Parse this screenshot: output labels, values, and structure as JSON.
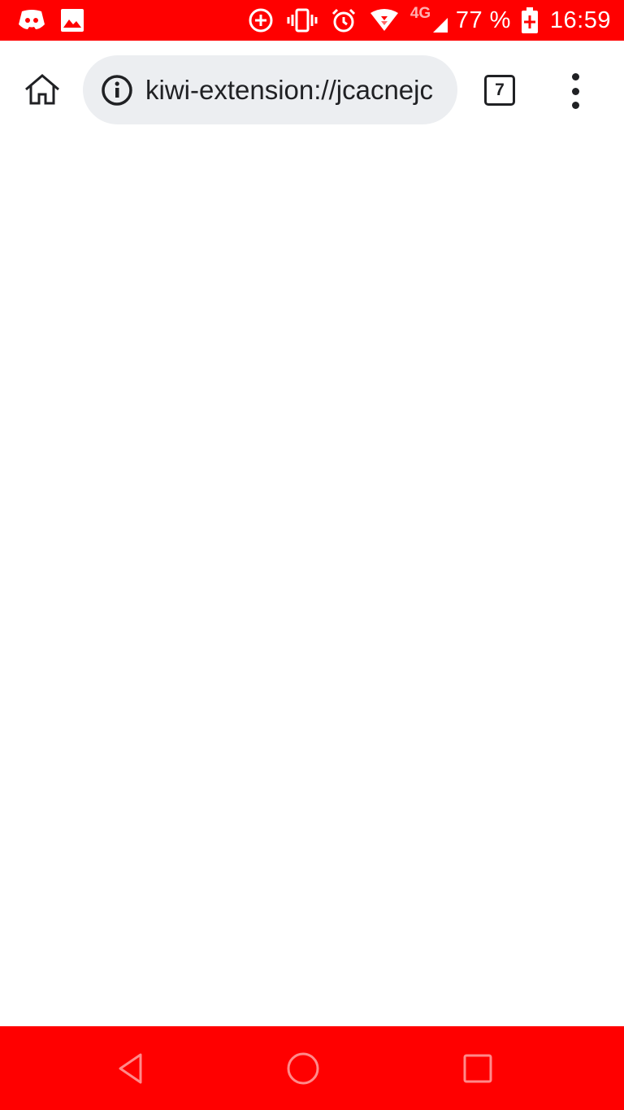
{
  "status_bar": {
    "background": "#ff0000",
    "left_icons": [
      "discord-icon",
      "image-icon"
    ],
    "right_icons": [
      "data-saver-icon",
      "vibrate-icon",
      "alarm-icon",
      "wifi-icon",
      "4g-lte-icon",
      "signal-icon",
      "battery-charging-icon"
    ],
    "network_label": "4G",
    "battery_percent": "77 %",
    "time": "16:59"
  },
  "toolbar": {
    "home_icon": "home-icon",
    "url_info_icon": "info-icon",
    "url": "kiwi-extension://jcacnejc",
    "tab_count": "7",
    "menu_icon": "more-vert-icon"
  },
  "nav_bar": {
    "background": "#ff0000",
    "buttons": [
      "back-icon",
      "home-circle-icon",
      "recents-icon"
    ]
  }
}
